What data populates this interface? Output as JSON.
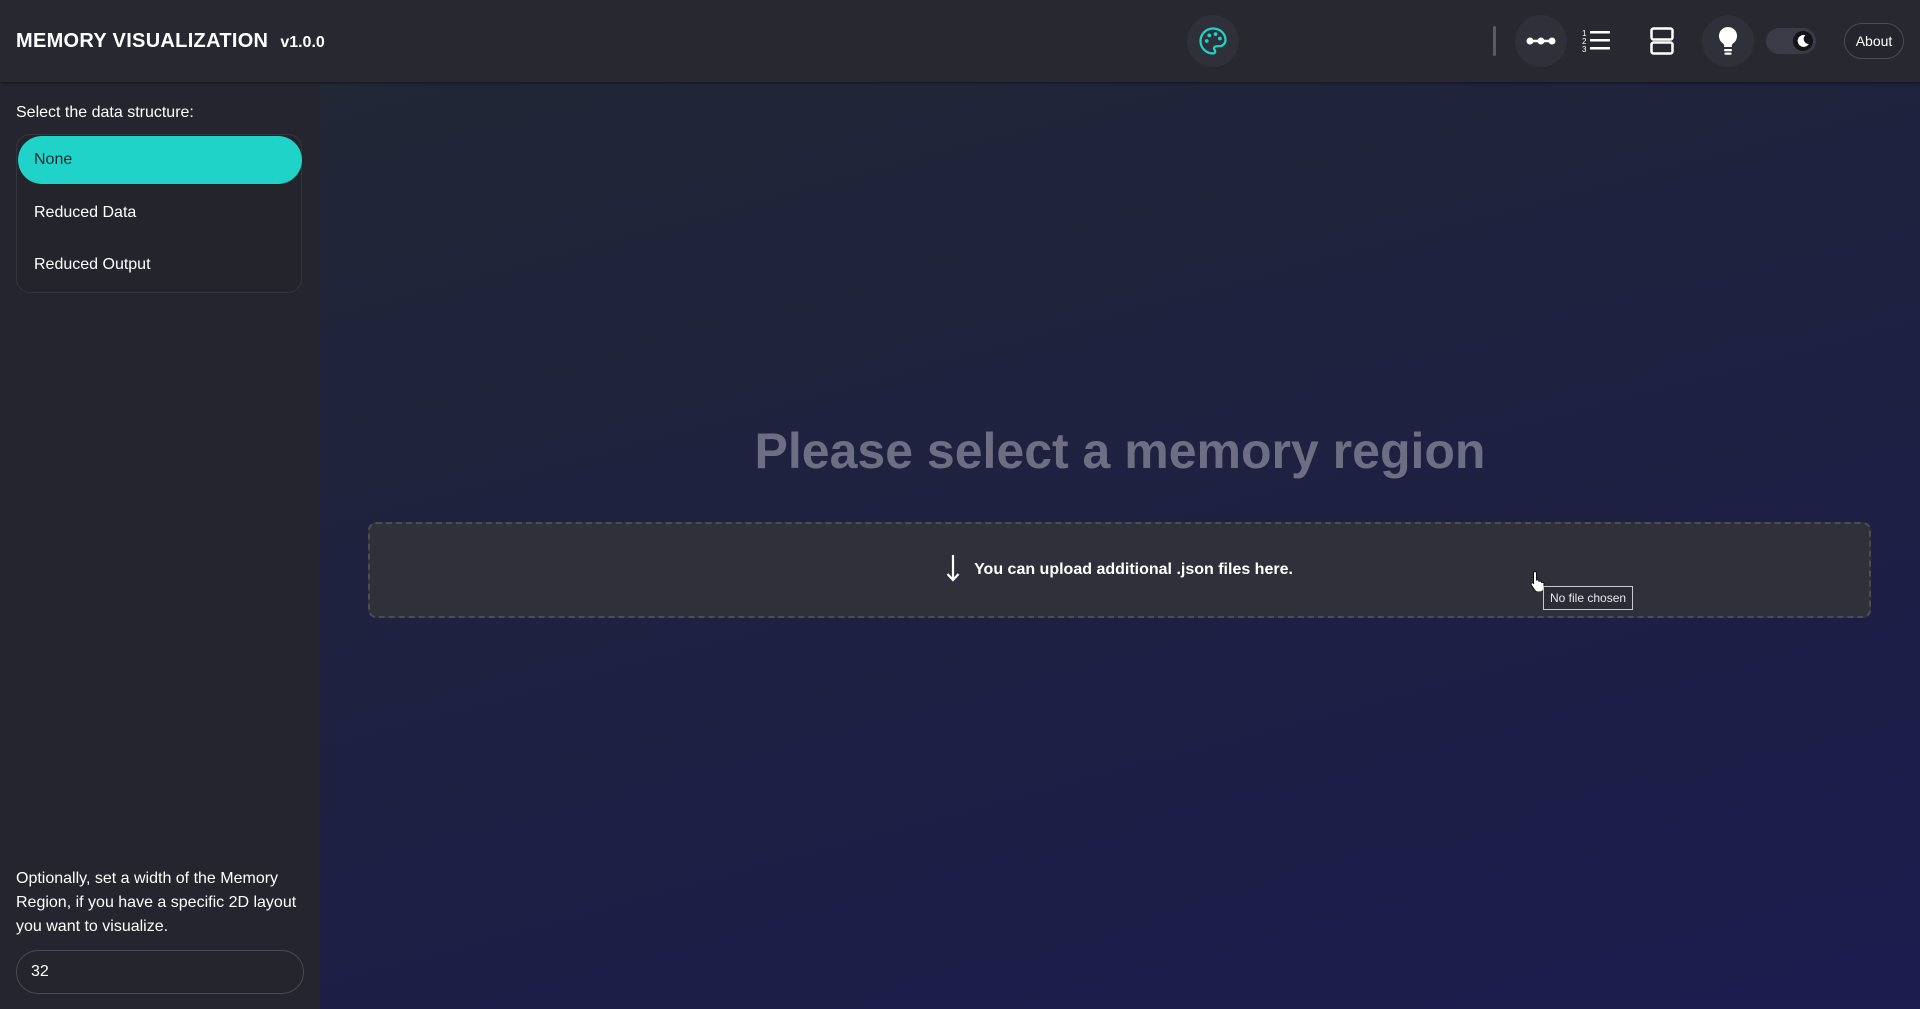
{
  "header": {
    "title": "MEMORY VISUALIZATION",
    "version": "v1.0.0",
    "icons": [
      "palette-icon",
      "linked-nodes-icon",
      "numbered-list-icon",
      "rows-layout-icon",
      "lightbulb-icon",
      "moon-icon"
    ],
    "about_label": "About",
    "theme_mode": "dark"
  },
  "sidebar": {
    "select_label": "Select the data structure:",
    "items": [
      {
        "label": "None",
        "selected": true
      },
      {
        "label": "Reduced Data",
        "selected": false
      },
      {
        "label": "Reduced Output",
        "selected": false
      }
    ],
    "help_text": "Optionally, set a width of the Memory Region, if you have a specific 2D layout you want to visualize.",
    "width_value": "32"
  },
  "main": {
    "title": "Please select a memory region",
    "upload_text": "You can upload additional .json files here.",
    "file_tooltip": "No file chosen"
  },
  "colors": {
    "accent": "#20d3c8",
    "topbar": "#272830",
    "sidebar": "#24252e",
    "title_muted": "#6d6e83"
  }
}
